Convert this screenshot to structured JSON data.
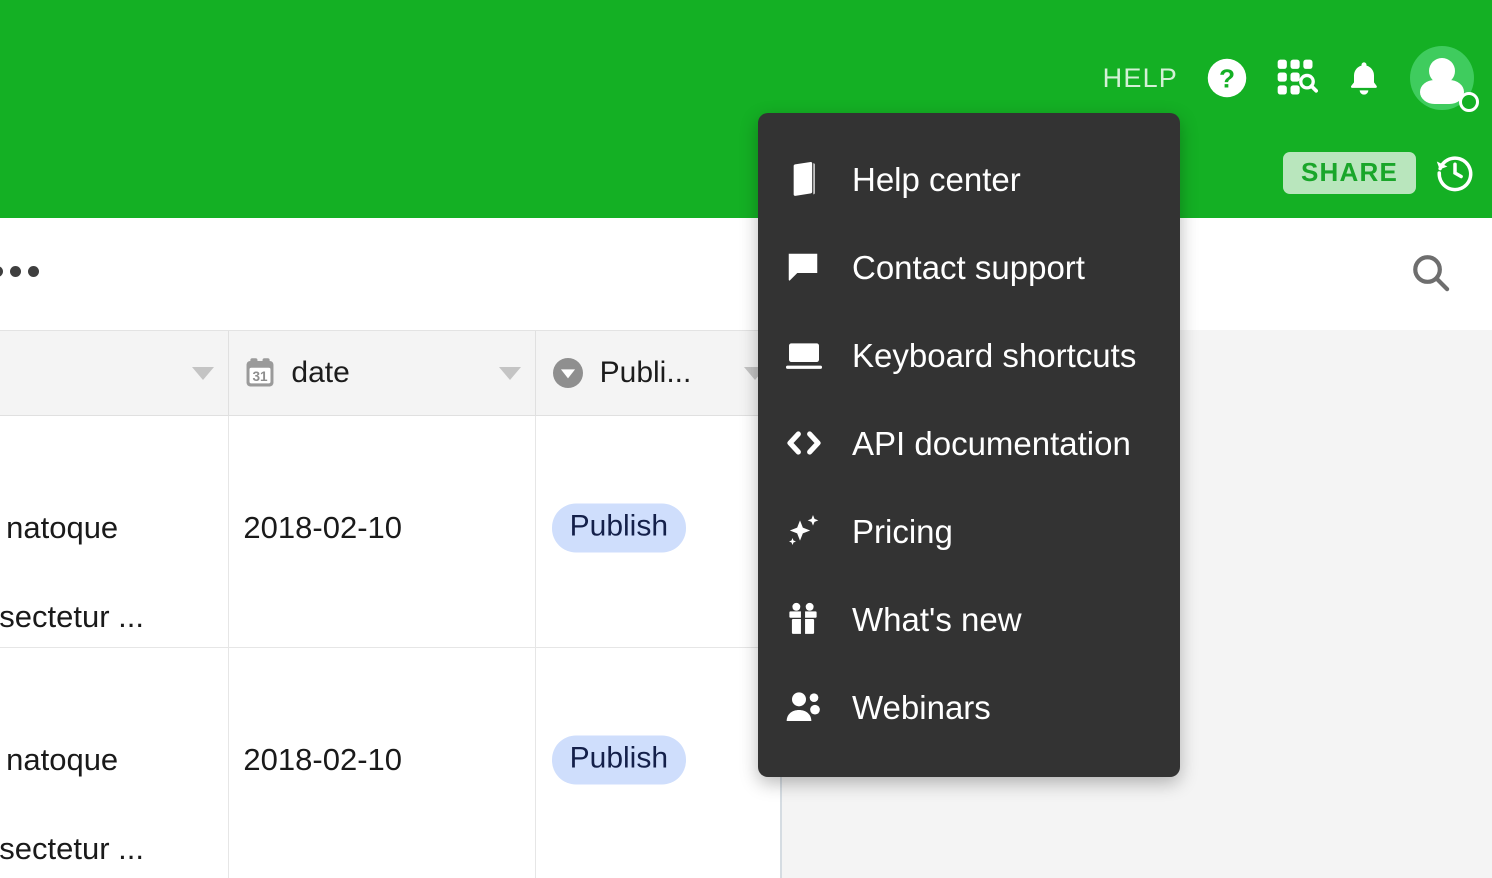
{
  "topbar": {
    "help_label": "HELP",
    "icons": [
      {
        "name": "help-circle-icon"
      },
      {
        "name": "apps-search-grid-icon"
      },
      {
        "name": "notifications-bell-icon"
      },
      {
        "name": "user-avatar"
      }
    ],
    "share_label": "SHARE",
    "history_icon": "history-clock-icon",
    "accent_green": "#14b024",
    "share_bg": "#b9e6bd",
    "share_text": "#1aa62a",
    "avatar_bg": "#3fcc5e"
  },
  "toolbar": {
    "overflow_icon": "more-horizontal-icon",
    "search_icon": "search-icon"
  },
  "help_menu": {
    "background": "#333333",
    "items": [
      {
        "label": "Help center",
        "icon": "book-icon"
      },
      {
        "label": "Contact support",
        "icon": "chat-bubble-icon"
      },
      {
        "label": "Keyboard shortcuts",
        "icon": "keyboard-icon"
      },
      {
        "label": "API documentation",
        "icon": "code-brackets-icon"
      },
      {
        "label": "Pricing",
        "icon": "sparkles-icon"
      },
      {
        "label": "What's new",
        "icon": "gift-icon"
      },
      {
        "label": "Webinars",
        "icon": "people-icon"
      }
    ]
  },
  "table": {
    "columns": [
      {
        "label": "",
        "icon": "",
        "caret": "chevron-down-icon"
      },
      {
        "label": "date",
        "icon": "calendar-31-icon",
        "caret": "chevron-down-icon"
      },
      {
        "label": "Publi...",
        "icon": "single-select-icon",
        "caret": "chevron-down-icon"
      }
    ],
    "rows": [
      {
        "name_top": "s natoque",
        "name_bottom": "nsectetur ...",
        "date": "2018-02-10",
        "status": "Publish"
      },
      {
        "name_top": "s natoque",
        "name_bottom": "nsectetur ...",
        "date": "2018-02-10",
        "status": "Publish"
      }
    ],
    "badge_bg": "#cfdefc",
    "badge_text": "#14204a"
  }
}
